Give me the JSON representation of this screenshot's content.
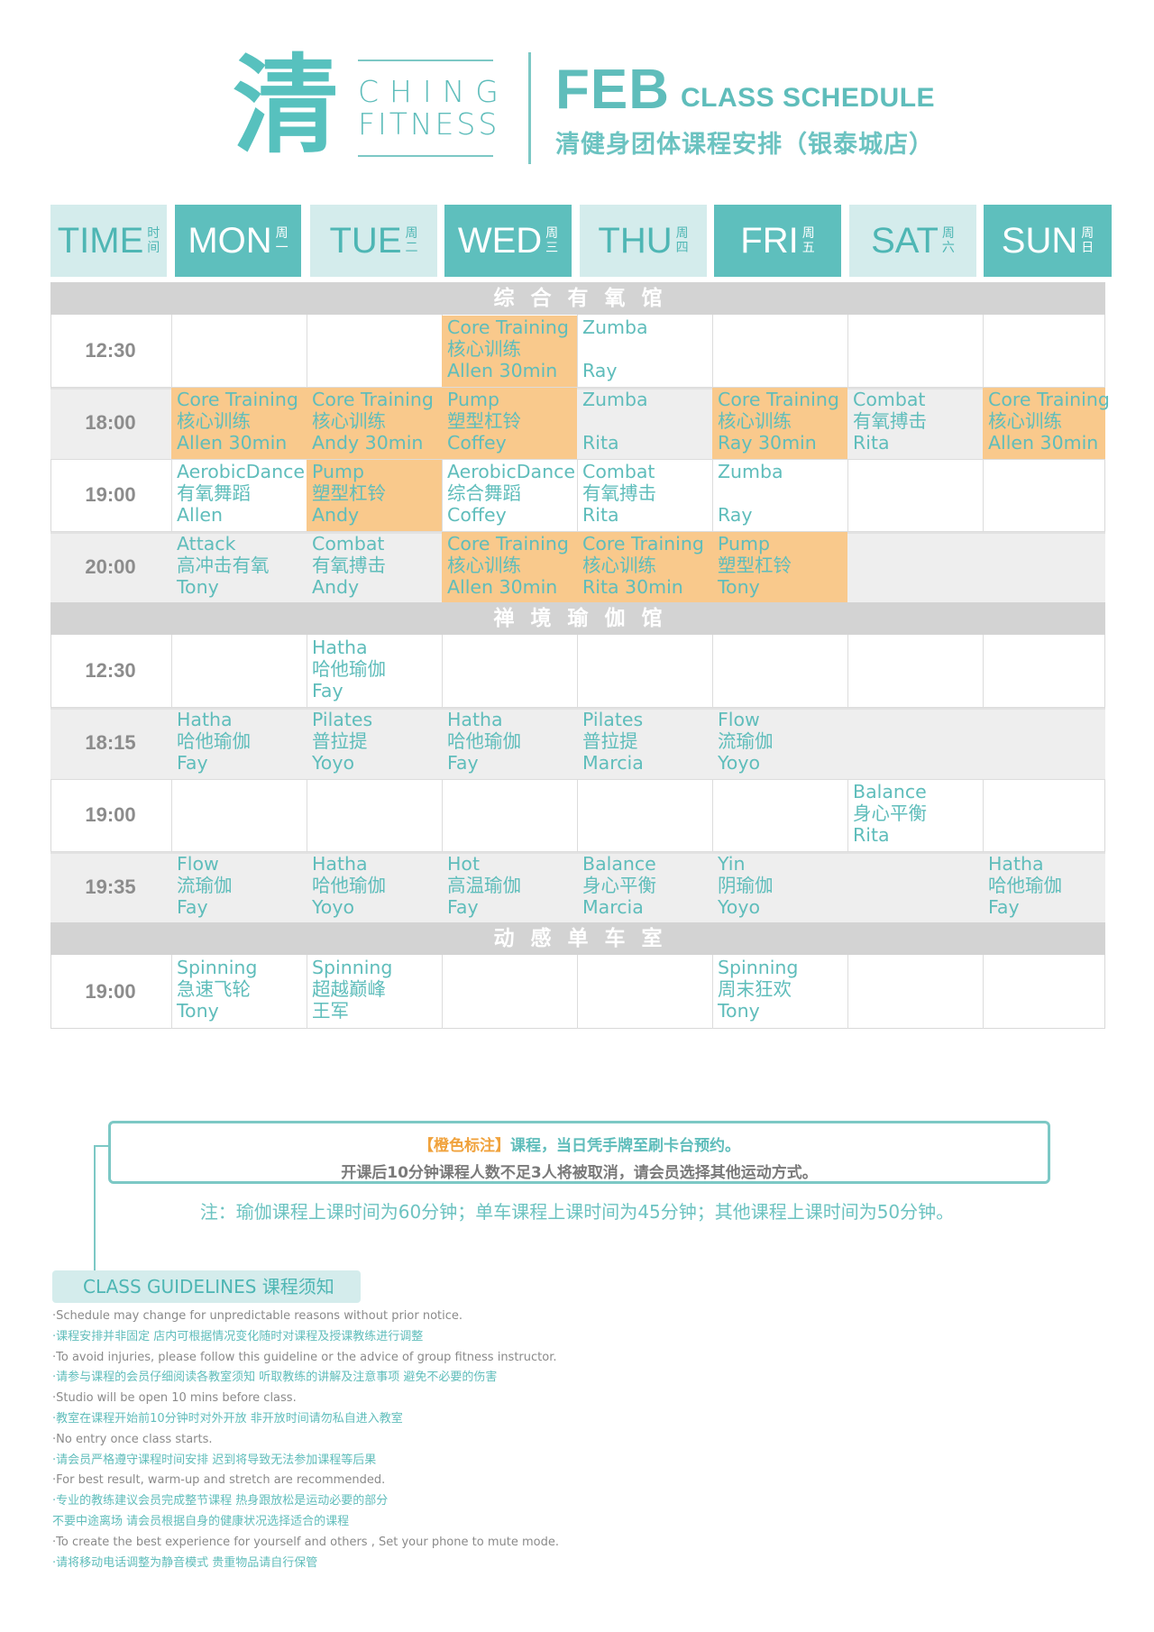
{
  "header": {
    "logo_char": "清",
    "brand_line1": "CHING",
    "brand_line2": "FITNESS",
    "month": "FEB",
    "title": "CLASS SCHEDULE",
    "subtitle": "清健身团体课程安排（银泰城店）"
  },
  "days": [
    {
      "en": "TIME",
      "cn1": "时",
      "cn2": "间"
    },
    {
      "en": "MON",
      "cn1": "周",
      "cn2": "一"
    },
    {
      "en": "TUE",
      "cn1": "周",
      "cn2": "二"
    },
    {
      "en": "WED",
      "cn1": "周",
      "cn2": "三"
    },
    {
      "en": "THU",
      "cn1": "周",
      "cn2": "四"
    },
    {
      "en": "FRI",
      "cn1": "周",
      "cn2": "五"
    },
    {
      "en": "SAT",
      "cn1": "周",
      "cn2": "六"
    },
    {
      "en": "SUN",
      "cn1": "周",
      "cn2": "日"
    }
  ],
  "sections": {
    "aerobic": "综合有氧馆",
    "yoga": "禅境瑜伽馆",
    "cycling": "动感单车室"
  },
  "aerobic_rows": [
    {
      "time": "12:30",
      "cells": [
        [],
        [],
        [
          "Core Training",
          "核心训练",
          "Allen 30min"
        ],
        [
          "Zumba",
          "",
          "Ray"
        ],
        [],
        [],
        []
      ]
    },
    {
      "time": "18:00",
      "cells": [
        [
          "Core Training",
          "核心训练",
          "Allen 30min"
        ],
        [
          "Core Training",
          "核心训练",
          "Andy 30min"
        ],
        [
          "Pump",
          "塑型杠铃",
          "Coffey"
        ],
        [
          "Zumba",
          "",
          "Rita"
        ],
        [
          "Core Training",
          "核心训练",
          "Ray 30min"
        ],
        [
          "Combat",
          "有氧搏击",
          "Rita"
        ],
        [
          "Core Training",
          "核心训练",
          "Allen 30min"
        ]
      ]
    },
    {
      "time": "19:00",
      "cells": [
        [
          "AerobicDance",
          "有氧舞蹈",
          "Allen"
        ],
        [
          "Pump",
          "塑型杠铃",
          "Andy"
        ],
        [
          "AerobicDance",
          "综合舞蹈",
          "Coffey"
        ],
        [
          "Combat",
          "有氧搏击",
          "Rita"
        ],
        [
          "Zumba",
          "",
          "Ray"
        ],
        [],
        []
      ]
    },
    {
      "time": "20:00",
      "cells": [
        [
          "Attack",
          "高冲击有氧",
          "Tony"
        ],
        [
          "Combat",
          "有氧搏击",
          "Andy"
        ],
        [
          "Core Training",
          "核心训练",
          "Allen 30min"
        ],
        [
          "Core Training",
          "核心训练",
          "Rita 30min"
        ],
        [
          "Pump",
          "塑型杠铃",
          "Tony"
        ],
        [],
        []
      ]
    }
  ],
  "yoga_rows": [
    {
      "time": "12:30",
      "cells": [
        [],
        [
          "Hatha",
          "哈他瑜伽",
          "Fay"
        ],
        [],
        [],
        [],
        [],
        []
      ]
    },
    {
      "time": "18:15",
      "cells": [
        [
          "Hatha",
          "哈他瑜伽",
          "Fay"
        ],
        [
          "Pilates",
          "普拉提",
          "Yoyo"
        ],
        [
          "Hatha",
          "哈他瑜伽",
          "Fay"
        ],
        [
          "Pilates",
          "普拉提",
          "Marcia"
        ],
        [
          "Flow",
          "流瑜伽",
          "Yoyo"
        ],
        [],
        []
      ]
    },
    {
      "time": "19:00",
      "cells": [
        [],
        [],
        [],
        [],
        [],
        [
          "Balance",
          "身心平衡",
          "Rita"
        ],
        []
      ]
    },
    {
      "time": "19:35",
      "cells": [
        [
          "Flow",
          "流瑜伽",
          "Fay"
        ],
        [
          "Hatha",
          "哈他瑜伽",
          "Yoyo"
        ],
        [
          "Hot",
          "高温瑜伽",
          "Fay"
        ],
        [
          "Balance",
          "身心平衡",
          "Marcia"
        ],
        [
          "Yin",
          "阴瑜伽",
          "Yoyo"
        ],
        [],
        [
          "Hatha",
          "哈他瑜伽",
          "Fay"
        ]
      ]
    }
  ],
  "cycling_rows": [
    {
      "time": "19:00",
      "cells": [
        [
          "Spinning",
          "急速飞轮",
          "Tony"
        ],
        [
          "Spinning",
          "超越巅峰",
          "王军"
        ],
        [],
        [],
        [
          "Spinning",
          "周末狂欢",
          "Tony"
        ],
        [],
        []
      ]
    }
  ],
  "highlight_color": "#f9c98c",
  "accent_color": "#5fbdbb",
  "notes": {
    "box_orange": "【橙色标注】",
    "box_line1_rest": "课程，当日凭手牌至刷卡台预约。",
    "box_line2": "开课后10分钟课程人数不足3人将被取消，请会员选择其他运动方式。",
    "duration_note": "注：瑜伽课程上课时间为60分钟；单车课程上课时间为45分钟；其他课程上课时间为50分钟。"
  },
  "guidelines": {
    "title": "CLASS GUIDELINES 课程须知",
    "items": [
      {
        "lang": "en",
        "text": "·Schedule may change for unpredictable reasons without prior notice."
      },
      {
        "lang": "cn",
        "text": "·课程安排并非固定 店内可根据情况变化随时对课程及授课教练进行调整"
      },
      {
        "lang": "en",
        "text": "·To avoid injuries, please follow this guideline or the advice of group fitness instructor."
      },
      {
        "lang": "cn",
        "text": "·请参与课程的会员仔细阅读各教室须知 听取教练的讲解及注意事项 避免不必要的伤害"
      },
      {
        "lang": "en",
        "text": "·Studio will be open 10 mins before class."
      },
      {
        "lang": "cn",
        "text": "·教室在课程开始前10分钟时对外开放 非开放时间请勿私自进入教室"
      },
      {
        "lang": "en",
        "text": "·No entry once class starts."
      },
      {
        "lang": "cn",
        "text": "·请会员严格遵守课程时间安排 迟到将导致无法参加课程等后果"
      },
      {
        "lang": "en",
        "text": "·For best result, warm-up and stretch are recommended."
      },
      {
        "lang": "cn",
        "text": "·专业的教练建议会员完成整节课程 热身跟放松是运动必要的部分"
      },
      {
        "lang": "cn",
        "text": "  不要中途离场 请会员根据自身的健康状况选择适合的课程"
      },
      {
        "lang": "en",
        "text": "·To create the best experience for yourself and others , Set your phone to mute mode."
      },
      {
        "lang": "cn",
        "text": "·请将移动电话调整为静音模式 贵重物品请自行保管"
      }
    ]
  }
}
